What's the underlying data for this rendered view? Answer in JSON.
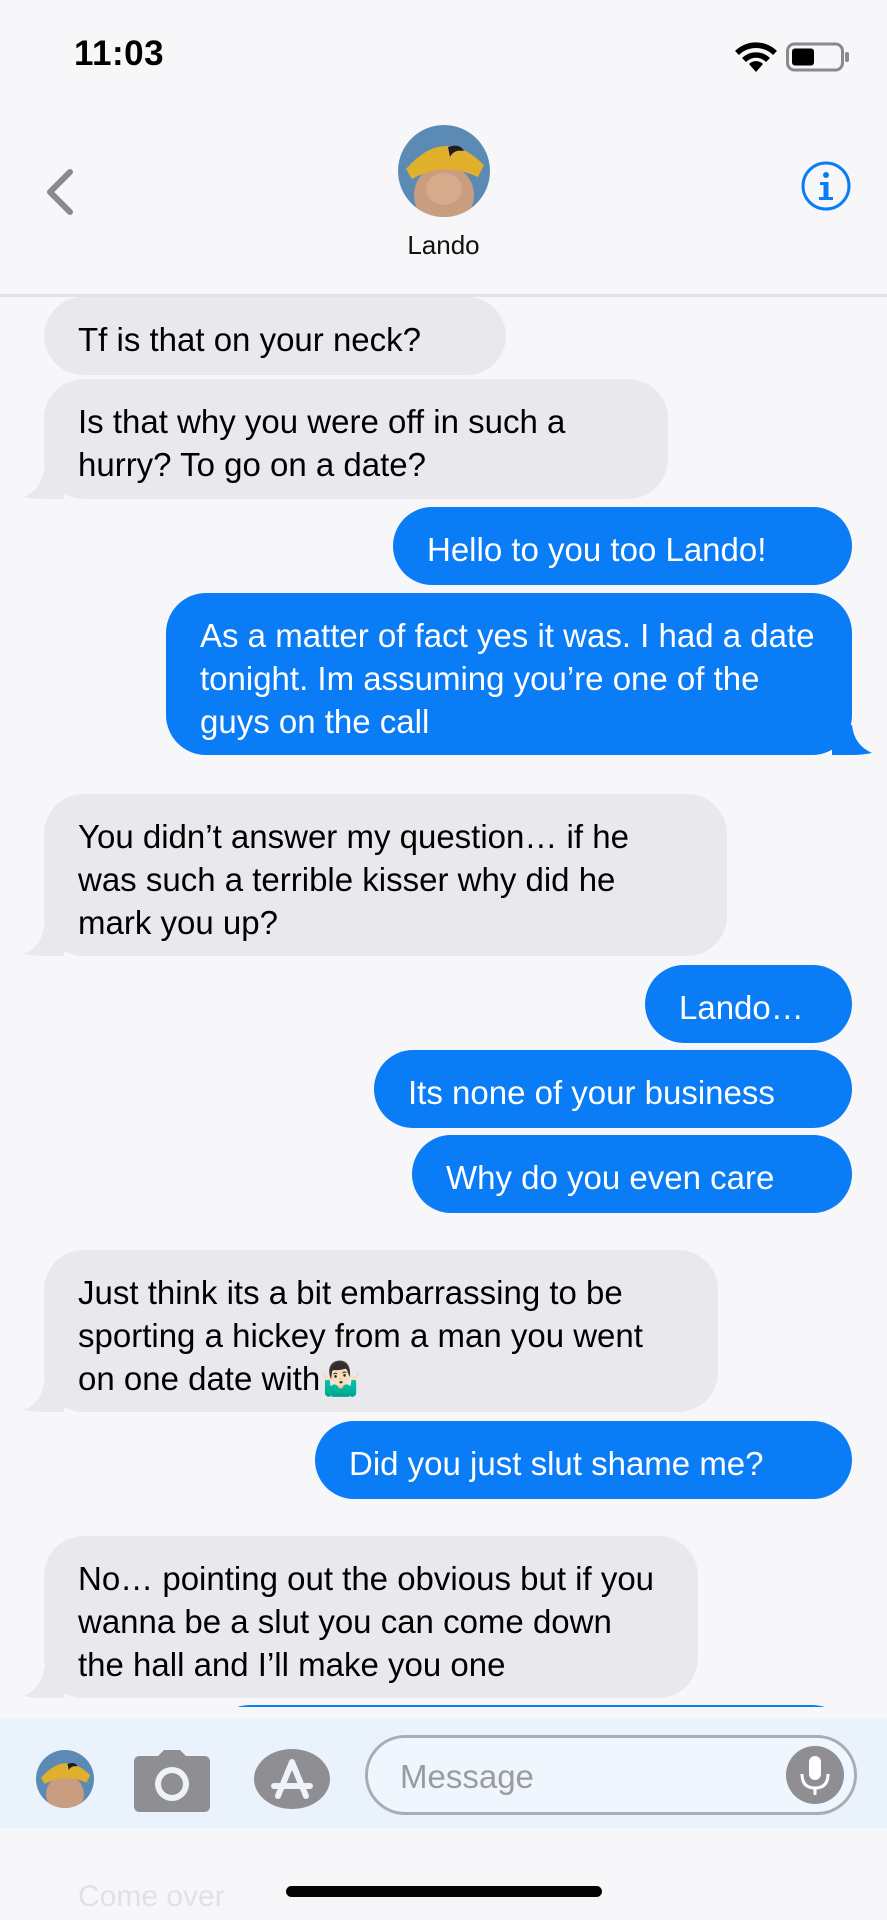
{
  "status_bar": {
    "time": "11:03"
  },
  "header": {
    "contact_name": "Lando"
  },
  "messages": [
    {
      "dir": "in",
      "text": "Tf is that on your neck?"
    },
    {
      "dir": "in",
      "text": "Is that why you were off in such a hurry? To go on a date?"
    },
    {
      "dir": "out",
      "text": "Hello to you too Lando!"
    },
    {
      "dir": "out",
      "text": "As a matter of fact yes it was. I had a date tonight. Im assuming you’re one of the guys on the call"
    },
    {
      "dir": "in",
      "text": "You didn’t answer my question… if he was such a terrible kisser why did he mark you up?"
    },
    {
      "dir": "out",
      "text": "Lando…"
    },
    {
      "dir": "out",
      "text": "Its none of your business"
    },
    {
      "dir": "out",
      "text": "Why do you even care"
    },
    {
      "dir": "in",
      "text": "Just think its a bit embarrassing to be sporting a hickey from a man you went on one date with🤷🏻‍♂️"
    },
    {
      "dir": "out",
      "text": "Did you just slut shame me?"
    },
    {
      "dir": "in",
      "text": "No… pointing out the obvious but if you wanna be a slut you can come down the hall and I’ll make you one"
    }
  ],
  "input": {
    "placeholder": "Message"
  },
  "below_input_text": "Come over",
  "icons": {
    "back": "chevron-left-icon",
    "info": "info-icon",
    "camera": "camera-icon",
    "apps": "app-store-icon",
    "mic": "microphone-icon"
  },
  "colors": {
    "accent": "#0a7cf6",
    "incoming_bubble": "#e9e9ed"
  }
}
